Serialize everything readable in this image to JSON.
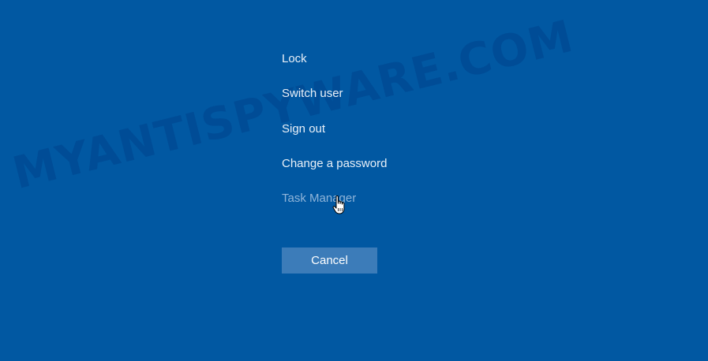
{
  "screen": {
    "background_color": "#0158a2"
  },
  "watermark": {
    "text": "MYANTISPYWARE.COM"
  },
  "menu": {
    "items": [
      {
        "label": "Lock"
      },
      {
        "label": "Switch user"
      },
      {
        "label": "Sign out"
      },
      {
        "label": "Change a password"
      },
      {
        "label": "Task Manager",
        "state": "hover"
      }
    ]
  },
  "cancel_button": {
    "label": "Cancel"
  },
  "cursor": {
    "icon": "hand-pointer-icon"
  }
}
